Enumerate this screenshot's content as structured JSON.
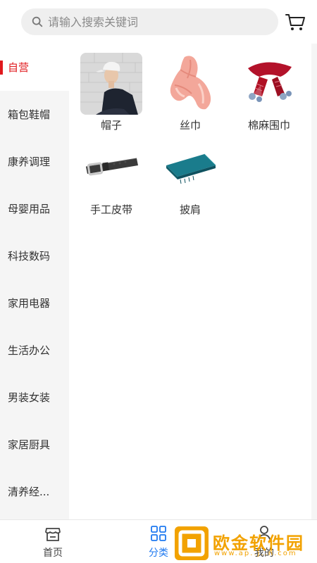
{
  "search": {
    "placeholder": "请输入搜索关键词"
  },
  "sidebar": {
    "items": [
      {
        "label": "自营",
        "active": true
      },
      {
        "label": "箱包鞋帽"
      },
      {
        "label": "康养调理"
      },
      {
        "label": "母婴用品"
      },
      {
        "label": "科技数码"
      },
      {
        "label": "家用电器"
      },
      {
        "label": "生活办公"
      },
      {
        "label": "男装女装"
      },
      {
        "label": "家居厨具"
      },
      {
        "label": "清养经..."
      }
    ]
  },
  "products": [
    {
      "label": "帽子"
    },
    {
      "label": "丝巾"
    },
    {
      "label": "棉麻围巾"
    },
    {
      "label": "手工皮带"
    },
    {
      "label": "披肩"
    }
  ],
  "tabbar": {
    "tabs": [
      {
        "label": "首页"
      },
      {
        "label": "分类",
        "active": true
      },
      {
        "label": "我的"
      }
    ]
  },
  "watermark": {
    "title": "欧金软件园",
    "url": "www.ap..j..n.com"
  },
  "colors": {
    "accent": "#e0191d",
    "tab_active": "#1f79f0",
    "watermark": "#f2a200"
  }
}
